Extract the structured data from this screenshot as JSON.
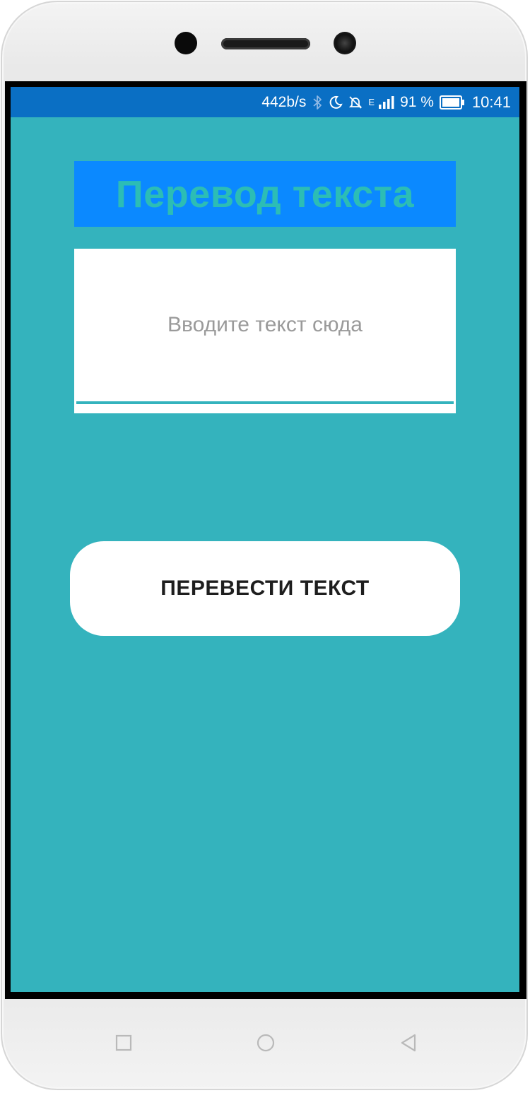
{
  "statusbar": {
    "net_speed": "442b/s",
    "network_type": "E",
    "battery_percent": "91 %",
    "time": "10:41",
    "icons": [
      "bluetooth-icon",
      "moon-icon",
      "muted-bell-icon",
      "signal-icon",
      "battery-icon"
    ]
  },
  "app": {
    "title": "Перевод текста",
    "input_placeholder": "Вводите текст сюда",
    "input_value": "",
    "translate_button_label": "ПЕРЕВЕСТИ ТЕКСТ"
  },
  "navbar": {
    "buttons": [
      "recents-square-icon",
      "home-circle-icon",
      "back-triangle-icon"
    ]
  },
  "colors": {
    "background": "#34b3bd",
    "statusbar": "#0a6fc4",
    "title_background": "#0b89ff",
    "title_text": "#2cbdb5",
    "input_background": "#ffffff",
    "button_background": "#ffffff",
    "button_text": "#1e1e1e"
  }
}
